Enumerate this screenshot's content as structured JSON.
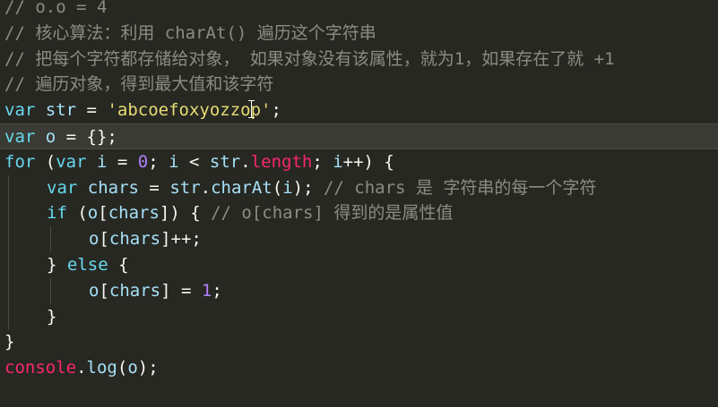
{
  "editor": {
    "lines": {
      "l1": "// o.o = 4",
      "l2": "// 核心算法：利用 charAt() 遍历这个字符串",
      "l3": "// 把每个字符都存储给对象， 如果对象没有该属性，就为1，如果存在了就 +1",
      "l4": "// 遍历对象，得到最大值和该字符",
      "l12_comment": "// chars 是 字符串的每一个字符",
      "l13_comment": "// o[chars] 得到的是属性值"
    },
    "code": {
      "var": "var",
      "for": "for",
      "if": "if",
      "else": "else",
      "str": "str",
      "o": "o",
      "i": "i",
      "chars": "chars",
      "string_a": "'abcoefoxyozzo",
      "string_b": "p'",
      "zero": "0",
      "one": "1",
      "length": "length",
      "charAt": "charAt",
      "console": "console",
      "log": "log"
    }
  },
  "colors": {
    "background": "#272822",
    "active_line": "#3a3b34",
    "comment": "#8c8c80",
    "keyword": "#66d9ef",
    "string": "#e6db74",
    "number": "#ae81ff",
    "property": "#f92672"
  }
}
